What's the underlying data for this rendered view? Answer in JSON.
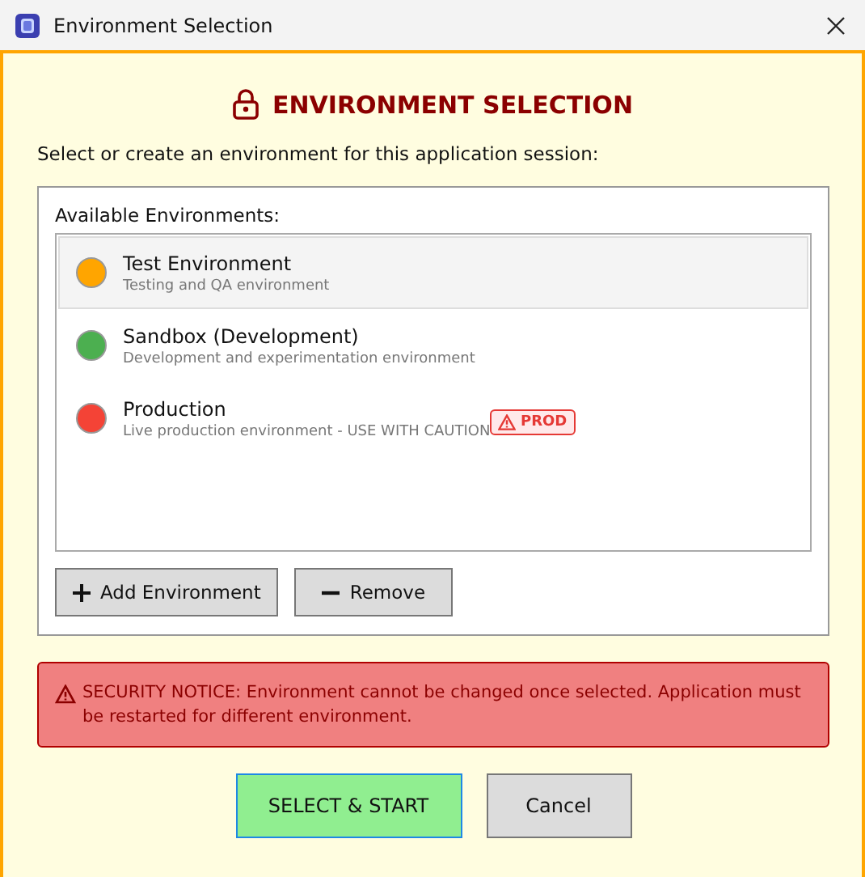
{
  "window": {
    "title": "Environment Selection"
  },
  "heading": "ENVIRONMENT SELECTION",
  "instruction": "Select or create an environment for this application session:",
  "environments_panel": {
    "label": "Available Environments:",
    "items": [
      {
        "name": "Test Environment",
        "description": "Testing and QA environment",
        "color": "#ffa500",
        "selected": true
      },
      {
        "name": "Sandbox (Development)",
        "description": "Development and experimentation environment",
        "color": "#4caf50",
        "selected": false
      },
      {
        "name": "Production",
        "description": "Live production environment - USE WITH CAUTION",
        "color": "#f44336",
        "selected": false,
        "badge": "PROD"
      }
    ],
    "buttons": [
      {
        "kind": "add",
        "label": "Add Environment"
      },
      {
        "kind": "remove",
        "label": "Remove"
      }
    ]
  },
  "notice": "SECURITY NOTICE: Environment cannot be changed once selected. Application must be restarted for different environment.",
  "buttons": [
    {
      "kind": "primary",
      "label": "SELECT & START"
    },
    {
      "kind": "secondary",
      "label": "Cancel"
    }
  ]
}
